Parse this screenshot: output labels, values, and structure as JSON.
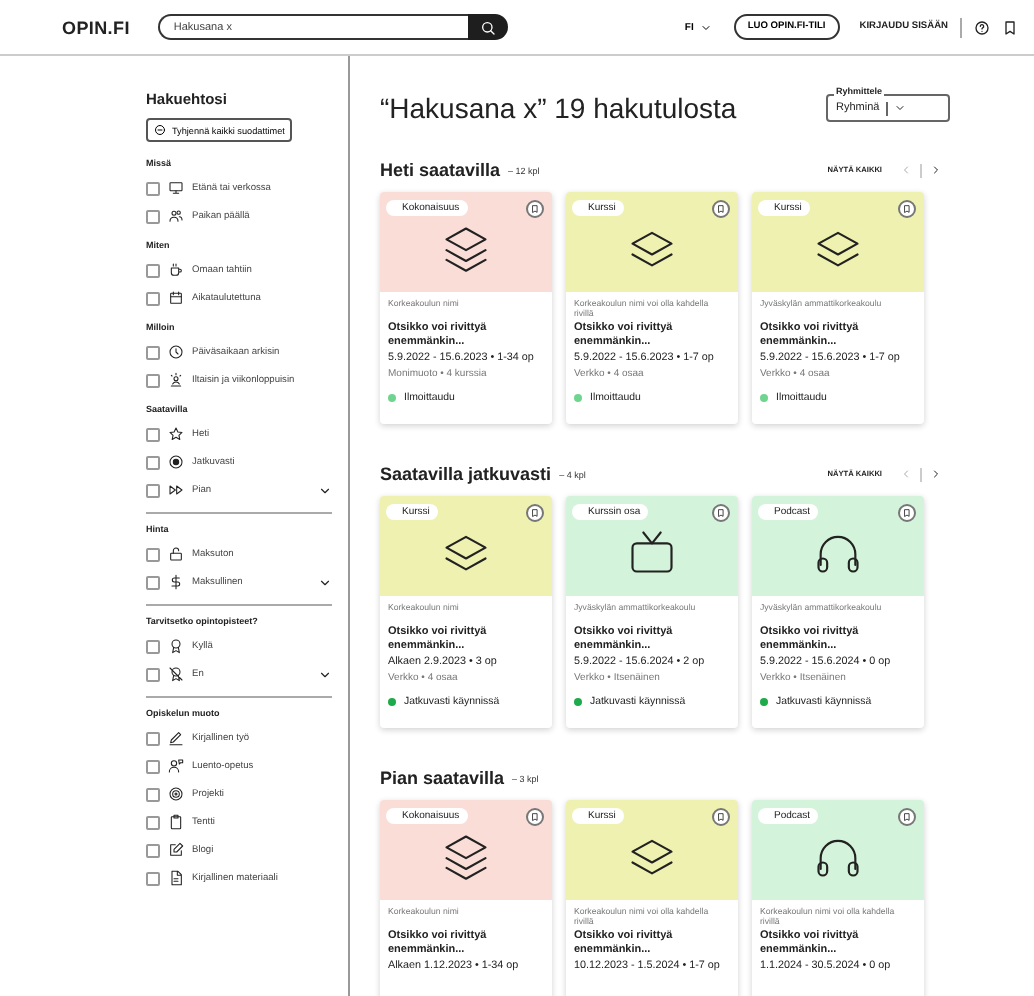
{
  "header": {
    "logo": "OPIN.FI",
    "search": {
      "value": "Hakusana x"
    },
    "language": "FI",
    "create_account": "LUO OPIN.FI-TILI",
    "login": "KIRJAUDU SISÄÄN"
  },
  "sidebar": {
    "title": "Hakuehtosi",
    "clear_button": "Tyhjennä kaikki suodattimet",
    "groups": [
      {
        "title": "Missä",
        "expandable": false,
        "items": [
          {
            "label": "Etänä tai verkossa",
            "kind": "monitor",
            "checked": false
          },
          {
            "label": "Paikan päällä",
            "kind": "people",
            "checked": false
          }
        ]
      },
      {
        "title": "Miten",
        "expandable": false,
        "items": [
          {
            "label": "Omaan tahtiin",
            "kind": "cup",
            "checked": false
          },
          {
            "label": "Aikataulutettuna",
            "kind": "calendar",
            "checked": false
          }
        ]
      },
      {
        "title": "Milloin",
        "expandable": false,
        "items": [
          {
            "label": "Päiväsaikaan arkisin",
            "kind": "clock",
            "checked": false
          },
          {
            "label": "Iltaisin ja viikonloppuisin",
            "kind": "person",
            "checked": false
          }
        ]
      },
      {
        "title": "Saatavilla",
        "expandable": true,
        "items": [
          {
            "label": "Heti",
            "kind": "star",
            "checked": false
          },
          {
            "label": "Jatkuvasti",
            "kind": "radio",
            "checked": false
          },
          {
            "label": "Pian",
            "kind": "forward",
            "checked": false
          }
        ]
      },
      {
        "title": "Hinta",
        "expandable": true,
        "items": [
          {
            "label": "Maksuton",
            "kind": "lock",
            "checked": false
          },
          {
            "label": "Maksullinen",
            "kind": "dollar",
            "checked": false
          }
        ]
      },
      {
        "title": "Tarvitsetko opintopisteet?",
        "expandable": true,
        "items": [
          {
            "label": "Kyllä",
            "kind": "award",
            "checked": false
          },
          {
            "label": "En",
            "kind": "award-off",
            "checked": false
          }
        ]
      },
      {
        "title": "Opiskelun muoto",
        "expandable": false,
        "items": [
          {
            "label": "Kirjallinen työ",
            "kind": "pen",
            "checked": false
          },
          {
            "label": "Luento-opetus",
            "kind": "speaker",
            "checked": false
          },
          {
            "label": "Projekti",
            "kind": "target",
            "checked": false
          },
          {
            "label": "Tentti",
            "kind": "clipboard",
            "checked": false
          },
          {
            "label": "Blogi",
            "kind": "edit",
            "checked": false
          },
          {
            "label": "Kirjallinen materiaali",
            "kind": "document",
            "checked": false
          }
        ]
      }
    ]
  },
  "results": {
    "title": "“Hakusana x” 19 hakutulosta",
    "grouping": {
      "label": "Ryhmittele",
      "value": "Ryhminä"
    },
    "sections": [
      {
        "title": "Heti saatavilla",
        "count": "– 12 kpl",
        "show_all": "NÄYTÄ KAIKKI",
        "cards": [
          {
            "type": "Kokonaisuus",
            "kind": "collection",
            "color": "#f9ddd6",
            "school": "Korkeakoulun nimi",
            "title": "Otsikko voi rivittyä enemmänkin...",
            "dates": "5.9.2022 - 15.6.2023 • 1-34 op",
            "details": "Monimuoto • 4 kurssia",
            "status": {
              "label": "Ilmoittaudu",
              "color": "#6fd58e"
            }
          },
          {
            "type": "Kurssi",
            "kind": "course",
            "color": "#eff1b0",
            "school": "Korkeakoulun nimi voi olla kahdella rivillä",
            "title": "Otsikko voi rivittyä enemmänkin...",
            "dates": "5.9.2022 - 15.6.2023 • 1-7 op",
            "details": "Verkko • 4 osaa",
            "status": {
              "label": "Ilmoittaudu",
              "color": "#6fd58e"
            }
          },
          {
            "type": "Kurssi",
            "kind": "course",
            "color": "#eff1b0",
            "school": "Jyväskylän ammattikorkeakoulu",
            "title": "Otsikko voi rivittyä enemmänkin...",
            "dates": "5.9.2022 - 15.6.2023 • 1-7 op",
            "details": "Verkko • 4 osaa",
            "status": {
              "label": "Ilmoittaudu",
              "color": "#6fd58e"
            }
          }
        ]
      },
      {
        "title": "Saatavilla jatkuvasti",
        "count": "– 4 kpl",
        "show_all": "NÄYTÄ KAIKKI",
        "cards": [
          {
            "type": "Kurssi",
            "kind": "course",
            "color": "#eff1b0",
            "school": "Korkeakoulun nimi",
            "title": "Otsikko voi rivittyä enemmänkin...",
            "dates": "Alkaen 2.9.2023 • 3 op",
            "details": "Verkko • 4 osaa",
            "status": {
              "label": "Jatkuvasti käynnissä",
              "color": "#1faa4b"
            }
          },
          {
            "type": "Kurssin osa",
            "kind": "course-part",
            "color": "#d3f4da",
            "school": "Jyväskylän ammattikorkeakoulu",
            "title": "Otsikko voi rivittyä enemmänkin...",
            "dates": "5.9.2022 - 15.6.2024 • 2 op",
            "details": "Verkko • Itsenäinen",
            "status": {
              "label": "Jatkuvasti käynnissä",
              "color": "#1faa4b"
            }
          },
          {
            "type": "Podcast",
            "kind": "podcast",
            "color": "#d3f4da",
            "school": "Jyväskylän ammattikorkeakoulu",
            "title": "Otsikko voi rivittyä enemmänkin...",
            "dates": "5.9.2022 - 15.6.2024 • 0 op",
            "details": "Verkko • Itsenäinen",
            "status": {
              "label": "Jatkuvasti käynnissä",
              "color": "#1faa4b"
            }
          }
        ]
      },
      {
        "title": "Pian saatavilla",
        "count": "– 3 kpl",
        "cards": [
          {
            "type": "Kokonaisuus",
            "kind": "collection",
            "color": "#f9ddd6",
            "school": "Korkeakoulun nimi",
            "title": "Otsikko voi rivittyä enemmänkin...",
            "dates": "Alkaen 1.12.2023 • 1-34 op"
          },
          {
            "type": "Kurssi",
            "kind": "course",
            "color": "#eff1b0",
            "school": "Korkeakoulun nimi voi olla kahdella rivillä",
            "title": "Otsikko voi rivittyä enemmänkin...",
            "dates": "10.12.2023 - 1.5.2024 • 1-7 op"
          },
          {
            "type": "Podcast",
            "kind": "podcast",
            "color": "#d3f4da",
            "school": "Korkeakoulun nimi voi olla kahdella rivillä",
            "title": "Otsikko voi rivittyä enemmänkin...",
            "dates": "1.1.2024 - 30.5.2024 • 0 op"
          }
        ]
      }
    ]
  }
}
